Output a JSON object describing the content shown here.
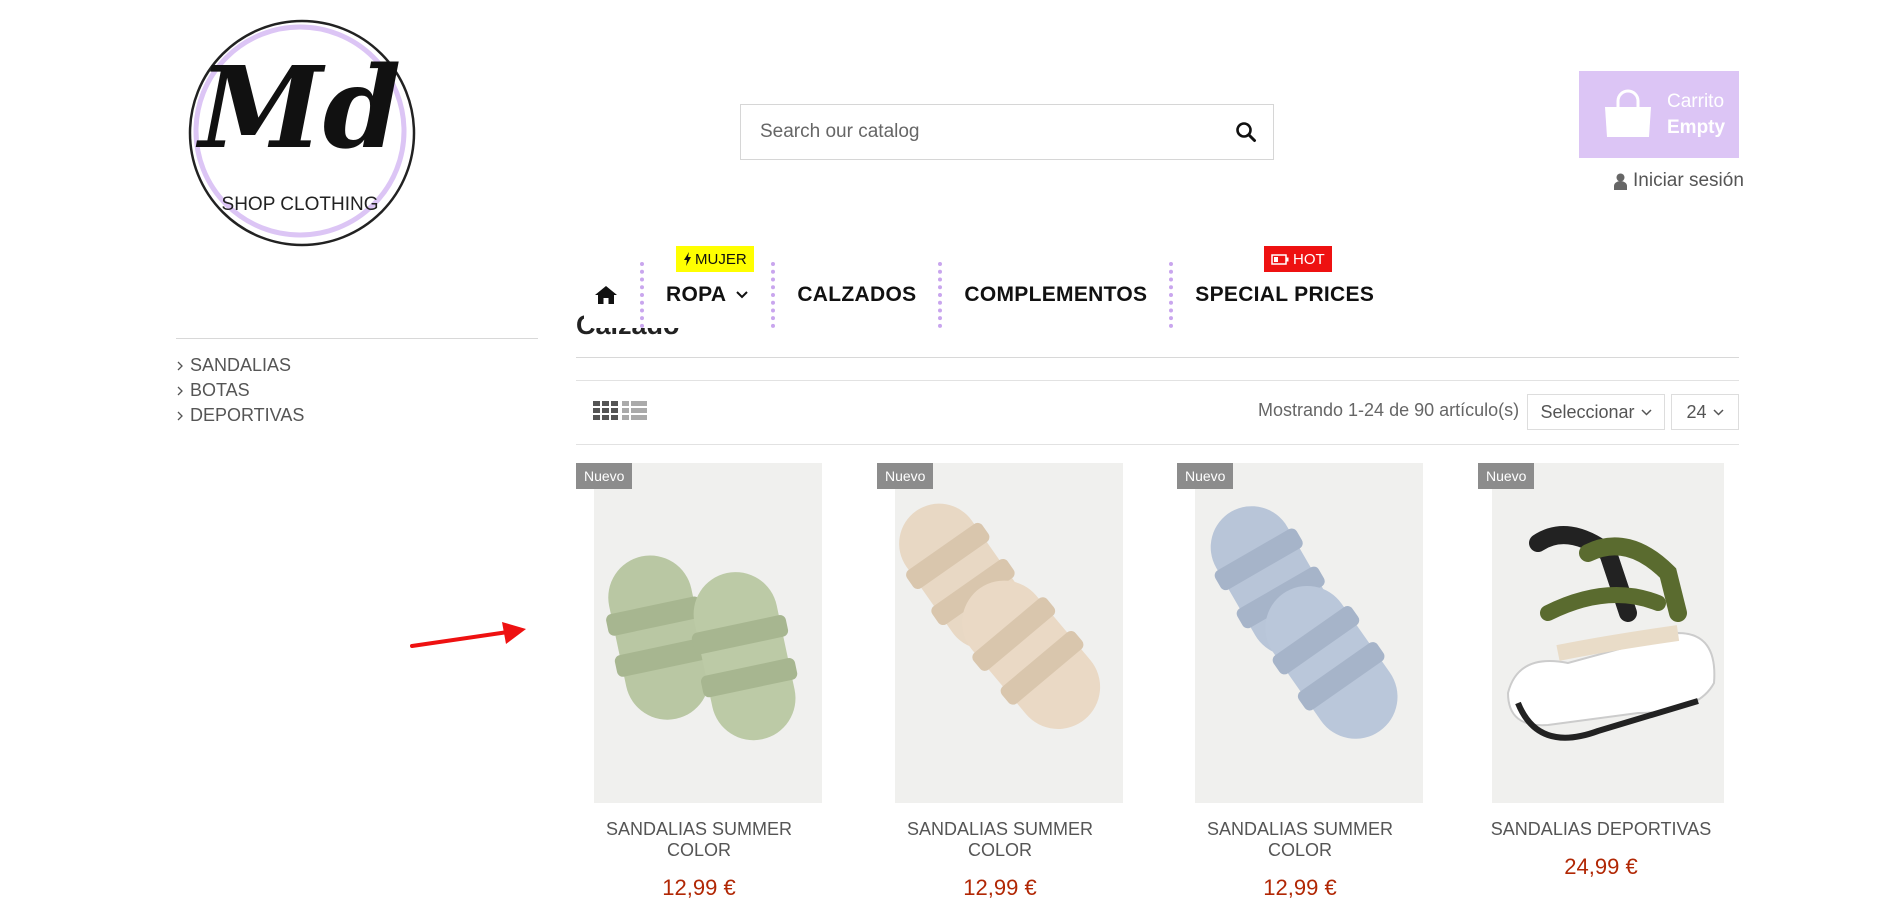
{
  "logo": {
    "monogram": "Md",
    "subtitle": "SHOP CLOTHING",
    "accent": "#dcc5f5"
  },
  "search": {
    "placeholder": "Search our catalog",
    "value": "",
    "icon": "search-icon"
  },
  "cart": {
    "label": "Carrito",
    "status": "Empty",
    "color": "#dcc5f5",
    "icon": "shopping-bag-icon"
  },
  "account": {
    "login_label": "Iniciar sesión",
    "icon": "user-icon"
  },
  "menu": {
    "home_icon": "home-icon",
    "items": [
      {
        "label": "ROPA",
        "has_dropdown": true
      },
      {
        "label": "CALZADOS",
        "has_dropdown": false
      },
      {
        "label": "COMPLEMENTOS",
        "has_dropdown": false
      },
      {
        "label": "SPECIAL PRICES",
        "has_dropdown": false
      }
    ],
    "badges": {
      "mujer": {
        "label": "MUJER",
        "color": "#ffff00",
        "icon": "bolt-icon"
      },
      "hot": {
        "label": "HOT",
        "color": "#ee1111",
        "icon": "battery-icon"
      }
    }
  },
  "page": {
    "title": "Calzado"
  },
  "sidebar": {
    "categories": [
      "SANDALIAS",
      "BOTAS",
      "DEPORTIVAS"
    ]
  },
  "toolbar": {
    "showing": "Mostrando 1-24 de 90 artículo(s)",
    "sort_label": "Seleccionar",
    "per_page": "24",
    "view_grid_icon": "grid-view-icon",
    "view_list_icon": "list-view-icon"
  },
  "products": [
    {
      "badge": "Nuevo",
      "name_line1": "SANDALIAS SUMMER",
      "name_line2": "COLOR",
      "price": "12,99 €",
      "color": "#b9c7a3"
    },
    {
      "badge": "Nuevo",
      "name_line1": "SANDALIAS SUMMER",
      "name_line2": "COLOR",
      "price": "12,99 €",
      "color": "#e8d8c4"
    },
    {
      "badge": "Nuevo",
      "name_line1": "SANDALIAS SUMMER",
      "name_line2": "COLOR",
      "price": "12,99 €",
      "color": "#b8c5d8"
    },
    {
      "badge": "Nuevo",
      "name_line1": "SANDALIAS DEPORTIVAS",
      "name_line2": "",
      "price": "24,99 €",
      "color": "#5a6b2f"
    }
  ],
  "colors": {
    "price": "#b12704",
    "badge_new": "#8c8c8c",
    "menu_separator": "#c9a6ee"
  }
}
